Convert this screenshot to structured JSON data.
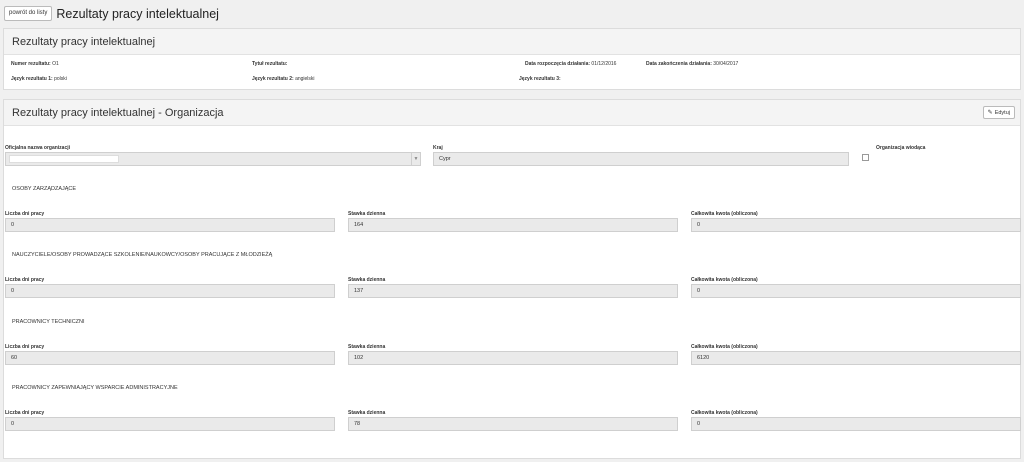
{
  "header": {
    "back_button": "powrót do listy",
    "title": "Rezultaty pracy intelektualnej"
  },
  "summary": {
    "title": "Rezultaty pracy intelektualnej",
    "number_label": "Numer rezultatu:",
    "number_value": "O1",
    "title_label": "Tytuł rezultatu:",
    "title_value": "",
    "start_label": "Data rozpoczęcia działania:",
    "start_value": "01/12/2016",
    "end_label": "Data zakończenia działania:",
    "end_value": "30/04/2017",
    "lang1_label": "Język rezultatu 1:",
    "lang1_value": "polski",
    "lang2_label": "Język rezultatu 2:",
    "lang2_value": "angielski",
    "lang3_label": "Język rezultatu 3:",
    "lang3_value": ""
  },
  "org": {
    "title": "Rezultaty pracy intelektualnej - Organizacja",
    "edit_button": "Edytuj",
    "org_name_label": "Oficjalna nazwa organizacji",
    "country_label": "Kraj",
    "country_value": "Cypr",
    "lead_label": "Organizacja wiodąca",
    "lead_checked": false,
    "sections": [
      {
        "title": "OSOBY ZARZĄDZAJĄCE",
        "days_label": "Liczba dni pracy",
        "days": "0",
        "rate_label": "Stawka dzienna",
        "rate": "164",
        "total_label": "Całkowita kwota (obliczona)",
        "total": "0"
      },
      {
        "title": "NAUCZYCIELE/OSOBY PROWADZĄCE SZKOLENIE/NAUKOWCY/OSOBY PRACUJĄCE Z MŁODZIEŻĄ",
        "days_label": "Liczba dni pracy",
        "days": "0",
        "rate_label": "Stawka dzienna",
        "rate": "137",
        "total_label": "Całkowita kwota (obliczona)",
        "total": "0"
      },
      {
        "title": "PRACOWNICY TECHNICZNI",
        "days_label": "Liczba dni pracy",
        "days": "60",
        "rate_label": "Stawka dzienna",
        "rate": "102",
        "total_label": "Całkowita kwota (obliczona)",
        "total": "6120"
      },
      {
        "title": "PRACOWNICY ZAPEWNIAJĄCY WSPARCIE ADMINISTRACYJNE",
        "days_label": "Liczba dni pracy",
        "days": "0",
        "rate_label": "Stawka dzienna",
        "rate": "78",
        "total_label": "Całkowita kwota (obliczona)",
        "total": "0"
      }
    ]
  }
}
